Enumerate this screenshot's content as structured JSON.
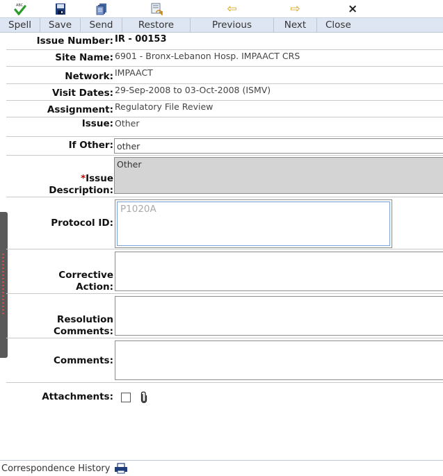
{
  "toolbar": {
    "spell_label": "Spell",
    "save_label": "Save",
    "send_label": "Send",
    "restore_label": "Restore",
    "previous_label": "Previous",
    "next_label": "Next",
    "close_label": "Close",
    "close_glyph": "×",
    "prev_glyph": "⇦",
    "next_glyph": "⇨"
  },
  "form": {
    "issue_number_label": "Issue Number:",
    "issue_number": "IR - 00153",
    "site_name_label": "Site Name:",
    "site_name": "6901 - Bronx-Lebanon Hosp. IMPAACT CRS",
    "network_label": "Network:",
    "network": "IMPAACT",
    "visit_dates_label": "Visit Dates:",
    "visit_dates": "29-Sep-2008 to 03-Oct-2008 (ISMV)",
    "assignment_label": "Assignment:",
    "assignment": "Regulatory File Review",
    "issue_label": "Issue:",
    "issue": "Other",
    "if_other_label": "If Other:",
    "if_other": "other",
    "issue_desc_required": "*",
    "issue_desc_label_1": "Issue",
    "issue_desc_label_2": "Description:",
    "issue_description": "Other",
    "protocol_id_label": "Protocol ID:",
    "protocol_id": "P1020A",
    "corrective_action_label_1": "Corrective",
    "corrective_action_label_2": "Action:",
    "resolution_comments_label_1": "Resolution",
    "resolution_comments_label_2": "Comments:",
    "comments_label": "Comments:",
    "attachments_label": "Attachments:"
  },
  "footer": {
    "correspondence_history": "Correspondence History"
  },
  "colors": {
    "toolbar_bg": "#dde6f2",
    "readonly_field_bg": "#d4d4d4",
    "required_marker": "#cc0000"
  }
}
